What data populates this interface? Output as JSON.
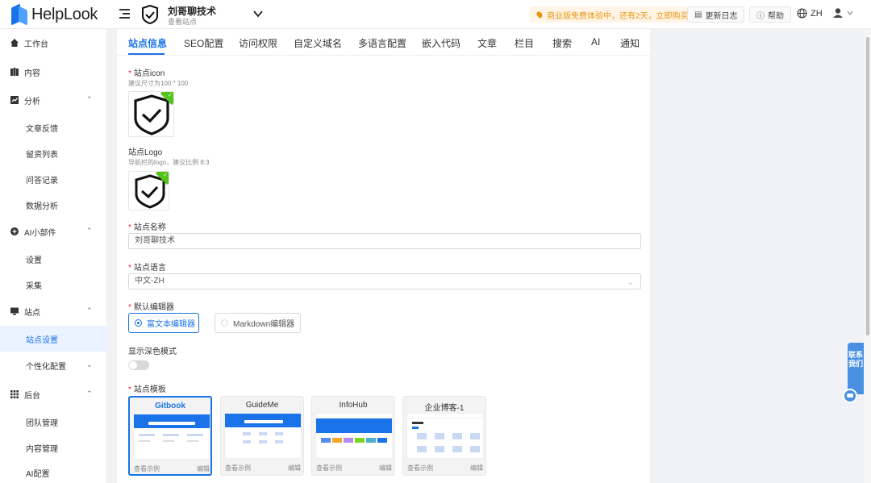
{
  "topbar": {
    "logo_text": "HelpLook",
    "site_name": "刘哥聊技术",
    "site_link": "查看站点",
    "promo": "商业版免费体验中，还有2天，立即购买",
    "changelog": "更新日志",
    "help": "帮助",
    "lang": "ZH"
  },
  "sidebar": {
    "items": [
      {
        "label": "工作台",
        "icon": "home-icon"
      },
      {
        "label": "内容",
        "icon": "book-icon"
      },
      {
        "label": "分析",
        "icon": "chart-icon"
      },
      {
        "label": "文章反馈"
      },
      {
        "label": "留资列表"
      },
      {
        "label": "问答记录"
      },
      {
        "label": "数据分析"
      },
      {
        "label": "AI小部件",
        "icon": "plus-circle-icon"
      },
      {
        "label": "设置"
      },
      {
        "label": "采集"
      },
      {
        "label": "站点",
        "icon": "monitor-icon"
      },
      {
        "label": "站点设置"
      },
      {
        "label": "个性化配置"
      },
      {
        "label": "后台",
        "icon": "grid-icon"
      },
      {
        "label": "团队管理"
      },
      {
        "label": "内容管理"
      },
      {
        "label": "AI配置"
      }
    ]
  },
  "tabs": [
    "站点信息",
    "SEO配置",
    "访问权限",
    "自定义域名",
    "多语言配置",
    "嵌入代码",
    "文章",
    "栏目",
    "搜索",
    "AI",
    "通知"
  ],
  "form": {
    "icon_label": "站点icon",
    "icon_hint": "建议尺寸为100 * 100",
    "logo_label": "站点Logo",
    "logo_hint": "导航栏的logo，建议比例 8:3",
    "name_label": "站点名称",
    "name_value": "刘哥聊技术",
    "lang_label": "站点语言",
    "lang_value": "中文-ZH",
    "editor_label": "默认编辑器",
    "editor_rich": "富文本编辑器",
    "editor_md": "Markdown编辑器",
    "dark_label": "显示深色模式",
    "template_label": "站点模板",
    "templates": [
      {
        "name": "Gitbook",
        "preview": "查看示例",
        "edit": "编辑"
      },
      {
        "name": "GuideMe",
        "preview": "查看示例",
        "edit": "编辑"
      },
      {
        "name": "InfoHub",
        "preview": "查看示例",
        "edit": "编辑"
      },
      {
        "name": "企业博客-1",
        "preview": "查看示例",
        "edit": "编辑"
      }
    ]
  },
  "contact": "联系我们",
  "colors": {
    "accent": "#1a73e8",
    "promo": "#e8960c",
    "success": "#52c41a"
  }
}
